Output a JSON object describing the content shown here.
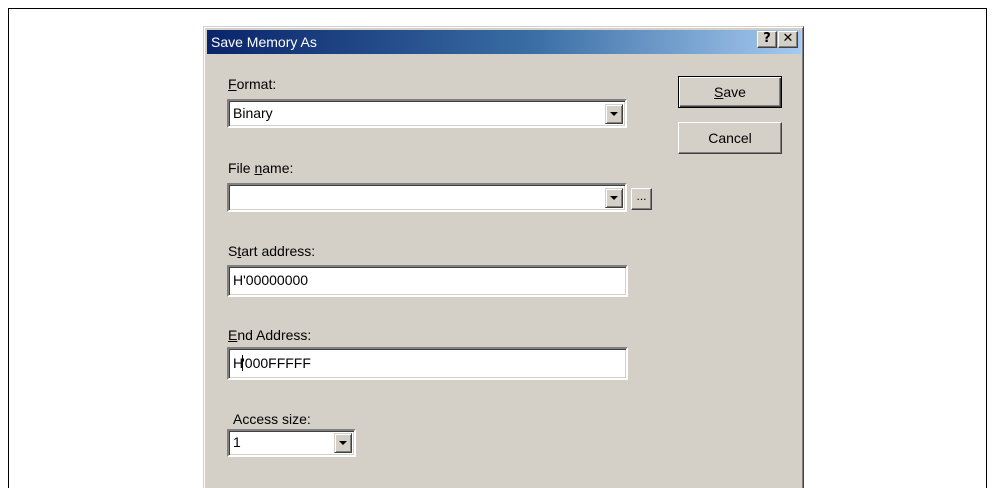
{
  "dialog": {
    "title": "Save Memory As",
    "help_glyph": "?",
    "close_glyph": "✕"
  },
  "format": {
    "label_mnemonic": "F",
    "label_rest": "ormat:",
    "value": "Binary"
  },
  "file_name": {
    "label_pre": "File ",
    "label_mnemonic": "n",
    "label_rest": "ame:",
    "value": "",
    "browse_label": "..."
  },
  "start_address": {
    "label_pre": "S",
    "label_mnemonic": "t",
    "label_rest": "art address:",
    "value": "H'00000000"
  },
  "end_address": {
    "label_mnemonic": "E",
    "label_rest": "nd Address:",
    "value_before_caret": "H",
    "value_after_caret": "'000FFFFF"
  },
  "access_size": {
    "label": "Access size:",
    "value": "1"
  },
  "buttons": {
    "save_mnemonic": "S",
    "save_rest": "ave",
    "cancel": "Cancel"
  },
  "icons": {
    "dropdown": "chevron-down-icon",
    "help": "help-icon",
    "close": "close-icon"
  }
}
